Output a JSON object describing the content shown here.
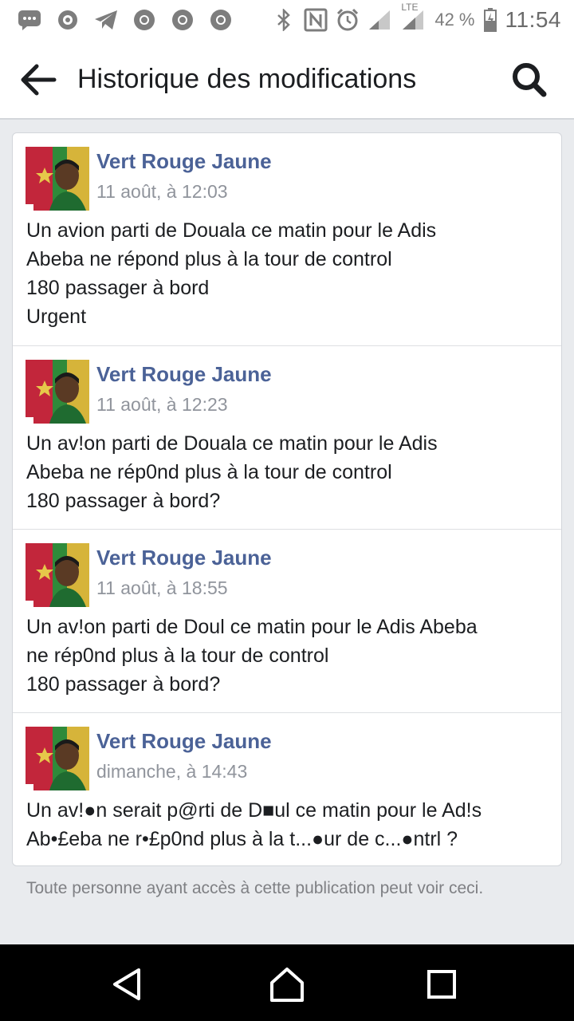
{
  "status_bar": {
    "icons": [
      "messenger-icon",
      "chat-bubble-icon",
      "telegram-icon",
      "chrome-icon",
      "chrome-icon",
      "chrome-icon",
      "bluetooth-icon",
      "nfc-icon",
      "alarm-icon",
      "signal-icon",
      "lte-signal-icon",
      "battery-icon"
    ],
    "lte_label": "LTE",
    "battery_percent": "42 %",
    "time": "11:54"
  },
  "header": {
    "back_icon": "arrow-left-icon",
    "title": "Historique des modifications",
    "search_icon": "search-icon"
  },
  "entries": [
    {
      "author": "Vert Rouge Jaune",
      "timestamp": "11 août, à 12:03",
      "text": "Un avion parti de Douala ce matin pour le Adis\nAbeba ne répond plus à la tour de control\n180 passager à bord\nUrgent"
    },
    {
      "author": "Vert Rouge Jaune",
      "timestamp": "11 août, à 12:23",
      "text": "Un av!on parti de Douala ce matin pour le Adis\nAbeba ne rép0nd plus à la tour de control\n180 passager à bord?"
    },
    {
      "author": "Vert Rouge Jaune",
      "timestamp": "11 août, à 18:55",
      "text": "Un av!on parti de Doul ce matin pour le Adis Abeba\nne rép0nd plus à la tour de control\n180 passager à bord?"
    },
    {
      "author": "Vert Rouge Jaune",
      "timestamp": "dimanche, à 14:43",
      "text": "Un av!●n serait p@rti de D■ul ce matin pour le Ad!s\nAb•£eba ne r•£p0nd plus à la t...●ur de c...●ntrl ?"
    }
  ],
  "footer": {
    "note": "Toute personne ayant accès à cette publication peut voir ceci."
  },
  "nav_bar": {
    "buttons": [
      "back-triangle-icon",
      "home-icon",
      "recents-icon"
    ]
  },
  "colors": {
    "author": "#4b6297",
    "timestamp": "#90949c",
    "background": "#e9ebee"
  }
}
